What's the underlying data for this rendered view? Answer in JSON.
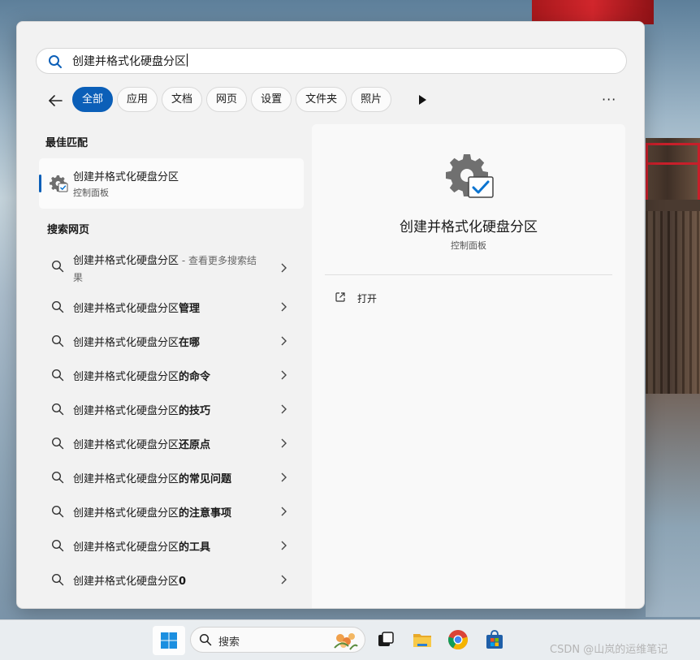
{
  "search": {
    "query": "创建并格式化硬盘分区"
  },
  "filters": {
    "tabs": [
      {
        "label": "全部",
        "active": true
      },
      {
        "label": "应用",
        "active": false
      },
      {
        "label": "文档",
        "active": false
      },
      {
        "label": "网页",
        "active": false
      },
      {
        "label": "设置",
        "active": false
      },
      {
        "label": "文件夹",
        "active": false
      },
      {
        "label": "照片",
        "active": false
      }
    ],
    "more": "···"
  },
  "best_match": {
    "section_title": "最佳匹配",
    "name": "创建并格式化硬盘分区",
    "category": "控制面板",
    "icon": "settings-gear-check-icon"
  },
  "web": {
    "section_title": "搜索网页",
    "first": {
      "query": "创建并格式化硬盘分区",
      "hint": " - 查看更多搜索结果"
    },
    "suggestions": [
      {
        "base": "创建并格式化硬盘分区",
        "suffix": "管理"
      },
      {
        "base": "创建并格式化硬盘分区",
        "suffix": "在哪"
      },
      {
        "base": "创建并格式化硬盘分区",
        "suffix": "的命令"
      },
      {
        "base": "创建并格式化硬盘分区",
        "suffix": "的技巧"
      },
      {
        "base": "创建并格式化硬盘分区",
        "suffix": "还原点"
      },
      {
        "base": "创建并格式化硬盘分区",
        "suffix": "的常见问题"
      },
      {
        "base": "创建并格式化硬盘分区",
        "suffix": "的注意事项"
      },
      {
        "base": "创建并格式化硬盘分区",
        "suffix": "的工具"
      },
      {
        "base": "创建并格式化硬盘分区",
        "suffix": "0"
      }
    ]
  },
  "preview": {
    "title": "创建并格式化硬盘分区",
    "subtitle": "控制面板",
    "open_label": "打开"
  },
  "taskbar": {
    "search_label": "搜索",
    "watermark": "CSDN @山岚的运维笔记",
    "apps": [
      "windows-start-icon",
      "task-view-icon",
      "file-explorer-icon",
      "chrome-icon",
      "microsoft-store-icon"
    ]
  },
  "colors": {
    "accent": "#0b5fb8",
    "panel": "#f2f2f2"
  }
}
